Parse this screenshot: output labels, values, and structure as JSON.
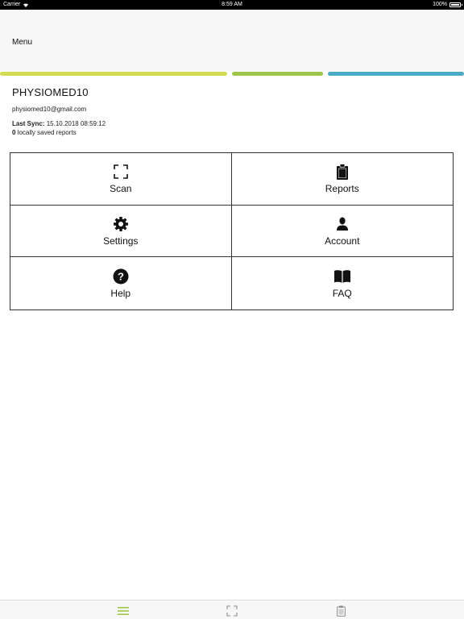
{
  "status_bar": {
    "carrier": "Carrier",
    "time": "8:59 AM",
    "battery": "100%",
    "battery_level": 1.0
  },
  "nav": {
    "title": "Menu"
  },
  "stripe_colors": [
    "#d3db55",
    "#9ec64a",
    "#4cabc7"
  ],
  "profile": {
    "username": "PHYSIOMED10",
    "email": "physiomed10@gmail.com",
    "last_sync_label": "Last Sync:",
    "last_sync_value": "15.10.2018 08:59:12",
    "saved_reports_count": "0",
    "saved_reports_text": "locally saved reports"
  },
  "menu_grid": [
    {
      "label": "Scan",
      "icon": "scan-frame-icon"
    },
    {
      "label": "Reports",
      "icon": "clipboard-icon"
    },
    {
      "label": "Settings",
      "icon": "gear-icon"
    },
    {
      "label": "Account",
      "icon": "person-icon"
    },
    {
      "label": "Help",
      "icon": "question-icon"
    },
    {
      "label": "FAQ",
      "icon": "book-icon"
    }
  ],
  "tab_bar": {
    "active_color": "#9ec64a",
    "tabs": [
      {
        "icon": "hamburger-menu-icon",
        "active": true
      },
      {
        "icon": "scan-frame-icon",
        "active": false
      },
      {
        "icon": "clipboard-icon",
        "active": false
      }
    ]
  }
}
